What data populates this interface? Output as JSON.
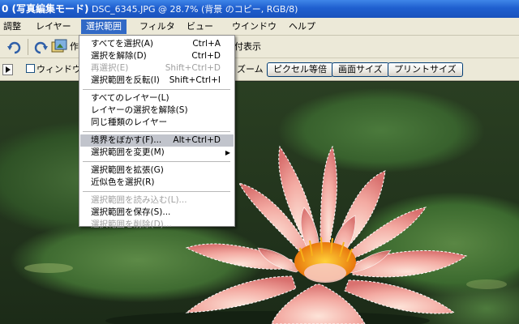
{
  "titlebar": {
    "prefix": "0 (写真編集モード)",
    "rest": "  DSC_6345.JPG @ 28.7% (背景 のコピー, RGB/8)"
  },
  "menubar": {
    "items": [
      "調整",
      "レイヤー",
      "選択範囲",
      "フィルタ",
      "ビュー",
      "ウインドウ",
      "ヘルプ"
    ]
  },
  "toolbar1": {
    "label_partial": "作",
    "right_text": "付表示"
  },
  "toolbar2": {
    "window_fit_label": "ウィンドウサイ",
    "zoom_label": "ズーム",
    "pixel_button": "ピクセル等倍",
    "screen_button": "画面サイズ",
    "print_button": "プリントサイズ"
  },
  "dropdown": {
    "items": [
      {
        "label": "すべてを選択(A)",
        "shortcut": "Ctrl+A",
        "disabled": false
      },
      {
        "label": "選択を解除(D)",
        "shortcut": "Ctrl+D",
        "disabled": false
      },
      {
        "label": "再選択(E)",
        "shortcut": "Shift+Ctrl+D",
        "disabled": true
      },
      {
        "label": "選択範囲を反転(I)",
        "shortcut": "Shift+Ctrl+I",
        "disabled": false
      },
      {
        "label": "すべてのレイヤー(L)",
        "shortcut": "",
        "disabled": false
      },
      {
        "label": "レイヤーの選択を解除(S)",
        "shortcut": "",
        "disabled": false
      },
      {
        "label": "同じ種類のレイヤー",
        "shortcut": "",
        "disabled": false
      },
      {
        "label": "境界をぼかす(F)...",
        "shortcut": "Alt+Ctrl+D",
        "disabled": false,
        "highlight": true
      },
      {
        "label": "選択範囲を変更(M)",
        "shortcut": "",
        "disabled": false,
        "submenu": true
      },
      {
        "label": "選択範囲を拡張(G)",
        "shortcut": "",
        "disabled": false
      },
      {
        "label": "近似色を選択(R)",
        "shortcut": "",
        "disabled": false
      },
      {
        "label": "選択範囲を読み込む(L)...",
        "shortcut": "",
        "disabled": true
      },
      {
        "label": "選択範囲を保存(S)...",
        "shortcut": "",
        "disabled": false
      },
      {
        "label": "選択範囲を削除(D)...",
        "shortcut": "",
        "disabled": true
      }
    ]
  },
  "icons": {
    "rotate": "rotate-icon",
    "nav_arrow": "play-arrow-icon",
    "submenu_arrow": "submenu-arrow-icon"
  },
  "colors": {
    "titlebar": "#1f5fcf",
    "menu_active": "#3169c6",
    "menu_highlight": "#c1c4cc",
    "flower_pink": "#f2a7a0",
    "flower_center": "#f39a1e"
  }
}
